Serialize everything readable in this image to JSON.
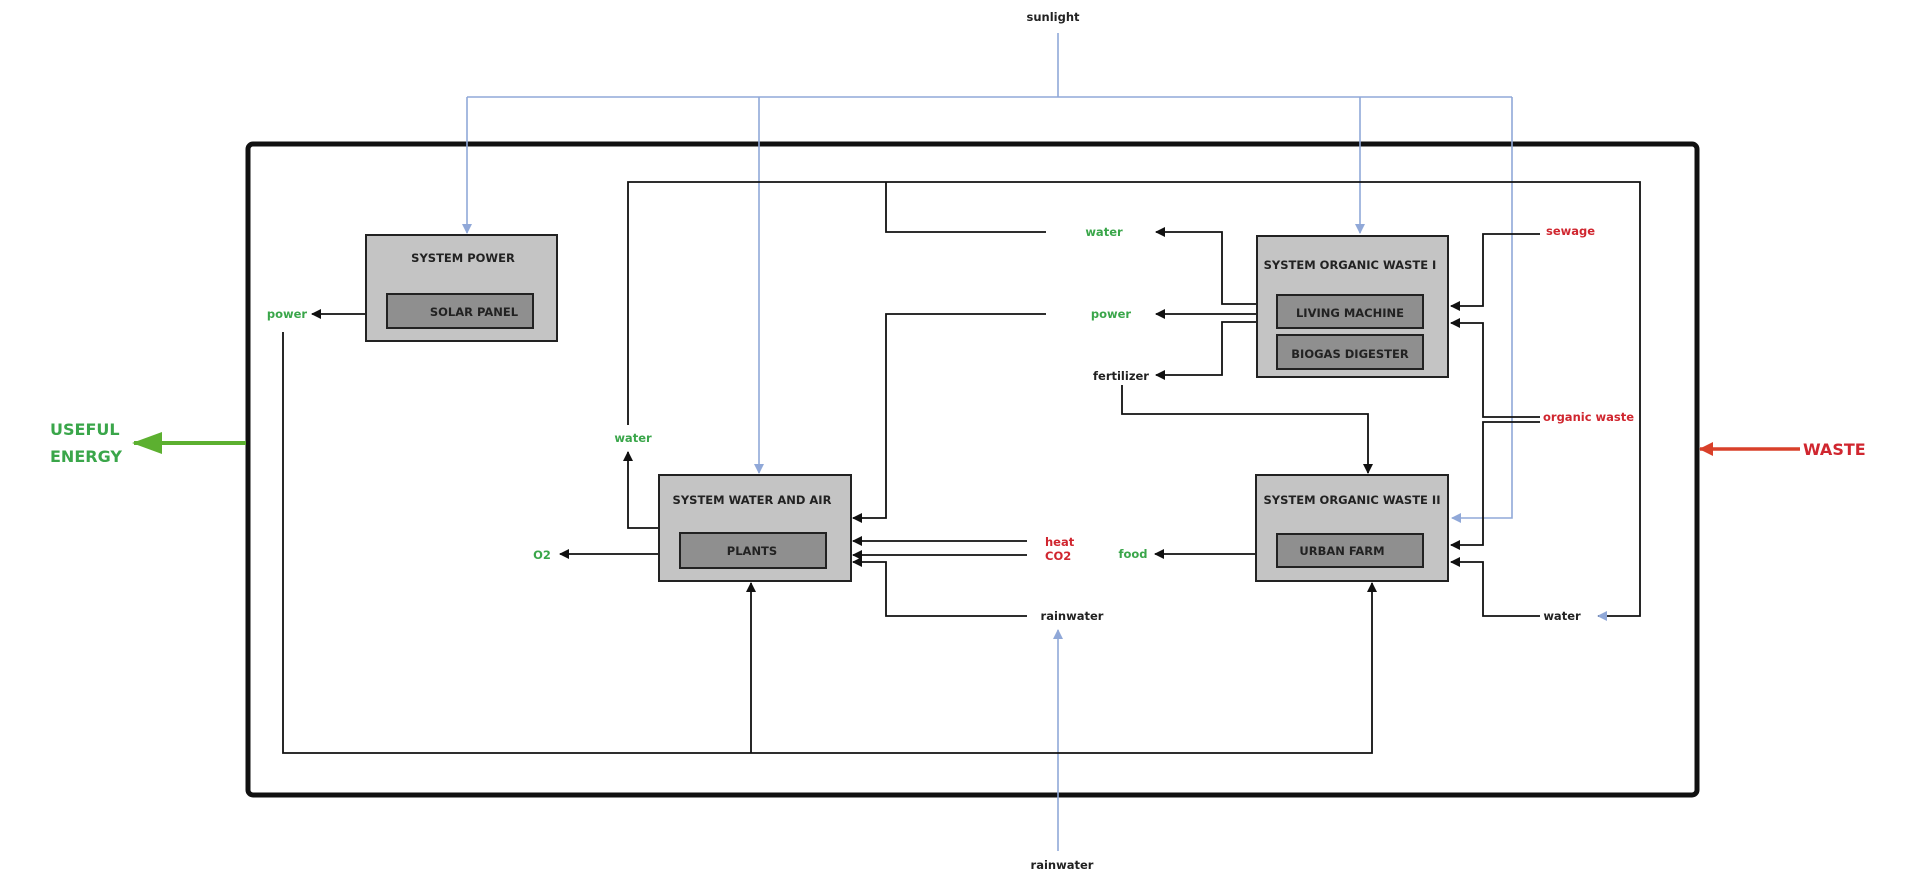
{
  "colors": {
    "green": "#3aa64a",
    "red": "#d0262f",
    "blue": "#90a8d8",
    "dark": "#222222",
    "box_fill": "#c4c4c4",
    "inner_fill": "#8f8f8f",
    "energy_arrow": "#5cb030",
    "waste_arrow": "#d9402a"
  },
  "external": {
    "sunlight": "sunlight",
    "rainwater": "rainwater",
    "useful_energy_line1": "USEFUL",
    "useful_energy_line2": "ENERGY",
    "waste": "WASTE"
  },
  "systems": {
    "power": {
      "title": "SYSTEM POWER",
      "components": [
        "SOLAR PANEL"
      ]
    },
    "water_air": {
      "title": "SYSTEM WATER AND AIR",
      "components": [
        "PLANTS"
      ]
    },
    "organic_waste_1": {
      "title": "SYSTEM ORGANIC WASTE I",
      "components": [
        "LIVING MACHINE",
        "BIOGAS DIGESTER"
      ]
    },
    "organic_waste_2": {
      "title": "SYSTEM ORGANIC WASTE II",
      "components": [
        "URBAN FARM"
      ]
    }
  },
  "flows": {
    "power_out": "power",
    "water_out_wa": "water",
    "o2": "O2",
    "water_ow1": "water",
    "power_ow1": "power",
    "fertilizer": "fertilizer",
    "heat": "heat",
    "co2": "CO2",
    "rainwater_in": "rainwater",
    "food": "food",
    "sewage": "sewage",
    "organic_waste": "organic waste",
    "water_ow2": "water"
  }
}
